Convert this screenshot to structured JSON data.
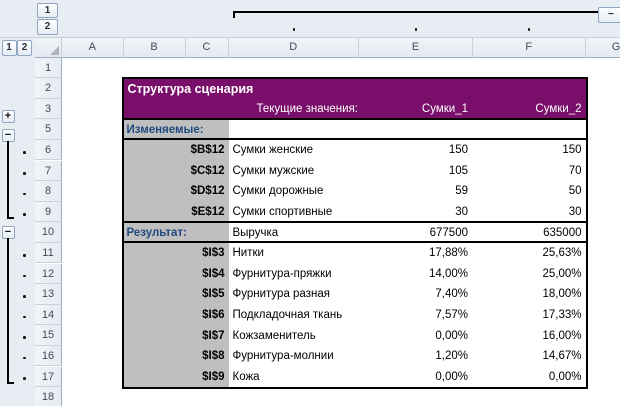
{
  "colors": {
    "table_header_purple": "#7A0E6B",
    "ref_cell_gray": "#BFBFBF",
    "section_label_navy": "#1F497D",
    "chrome_background": "#E8EDF4"
  },
  "outline": {
    "col_level_1": "1",
    "col_level_2": "2",
    "row_level_1": "1",
    "row_level_2": "2",
    "expand_glyph": "+",
    "collapse_glyph": "−"
  },
  "col_headers": [
    "A",
    "B",
    "C",
    "D",
    "E",
    "F",
    "G"
  ],
  "row_headers": [
    "1",
    "2",
    "3",
    "5",
    "6",
    "7",
    "8",
    "9",
    "10",
    "11",
    "12",
    "13",
    "14",
    "15",
    "16",
    "17",
    "18"
  ],
  "table": {
    "title": "Структура сценария",
    "current_values_label": "Текущие значения:",
    "scenario1_label": "Сумки_1",
    "scenario2_label": "Сумки_2",
    "changing_label": "Изменяемые:",
    "result_label": "Результат:",
    "changing_rows": [
      {
        "ref": "$B$12",
        "name": "Сумки женские",
        "v1": "150",
        "v2": "150"
      },
      {
        "ref": "$C$12",
        "name": "Сумки мужские",
        "v1": "105",
        "v2": "70"
      },
      {
        "ref": "$D$12",
        "name": "Сумки дорожные",
        "v1": "59",
        "v2": "50"
      },
      {
        "ref": "$E$12",
        "name": "Сумки спортивные",
        "v1": "30",
        "v2": "30"
      }
    ],
    "result_row": {
      "name": "Выручка",
      "v1": "677500",
      "v2": "635000"
    },
    "result_rows": [
      {
        "ref": "$I$3",
        "name": "Нитки",
        "v1": "17,88%",
        "v2": "25,63%"
      },
      {
        "ref": "$I$4",
        "name": "Фурнитура-пряжки",
        "v1": "14,00%",
        "v2": "25,00%"
      },
      {
        "ref": "$I$5",
        "name": "Фурнитура разная",
        "v1": "7,40%",
        "v2": "18,00%"
      },
      {
        "ref": "$I$6",
        "name": "Подкладочная ткань",
        "v1": "7,57%",
        "v2": "17,33%"
      },
      {
        "ref": "$I$7",
        "name": "Кожзаменитель",
        "v1": "0,00%",
        "v2": "16,00%"
      },
      {
        "ref": "$I$8",
        "name": "Фурнитура-молнии",
        "v1": "1,20%",
        "v2": "14,67%"
      },
      {
        "ref": "$I$9",
        "name": "Кожа",
        "v1": "0,00%",
        "v2": "0,00%"
      }
    ]
  }
}
